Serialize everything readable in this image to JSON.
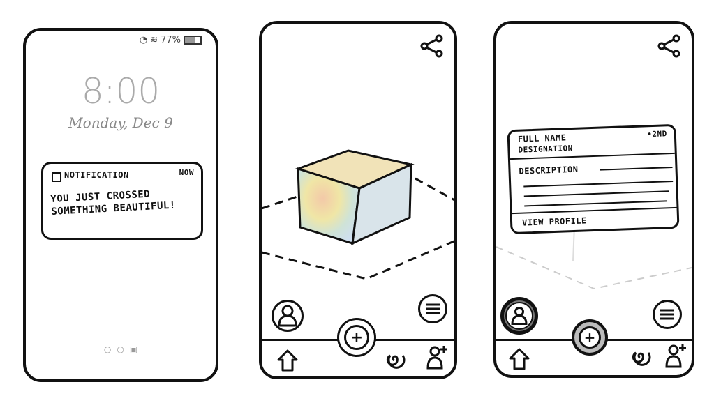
{
  "lockscreen": {
    "status_battery": "77%",
    "time": "8:00",
    "date": "Monday, Dec 9",
    "notification": {
      "title": "Notification",
      "time": "Now",
      "body": "You just crossed something beautiful!"
    }
  },
  "profile_card": {
    "full_name": "Full Name",
    "designation": "Designation",
    "degree": "•2nd",
    "description": "Description",
    "view_profile": "View Profile"
  },
  "icons": [
    "share-icon",
    "avatar-icon",
    "menu-icon",
    "add-icon",
    "home-icon",
    "spiral-icon",
    "add-user-icon"
  ]
}
